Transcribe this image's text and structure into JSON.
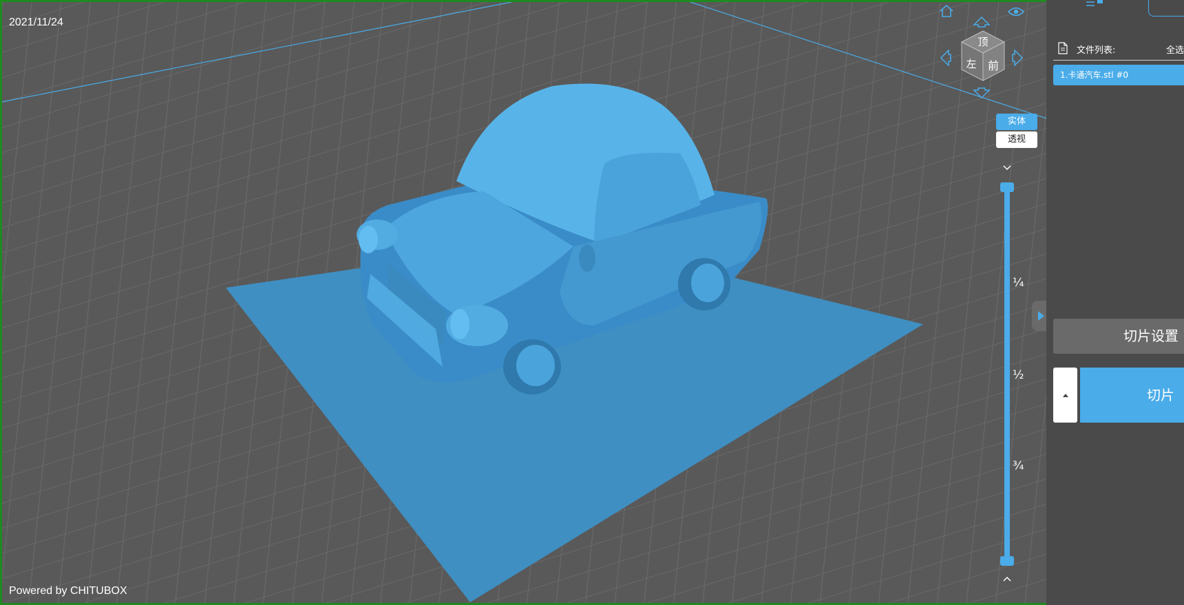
{
  "viewport": {
    "date": "2021/11/24",
    "powered_by": "Powered by CHITUBOX",
    "view_cube": {
      "top": "顶",
      "front": "前",
      "left": "左"
    },
    "view_modes": {
      "solid": "实体",
      "perspective": "透视"
    },
    "layer_slider": {
      "quarter": "¼",
      "half": "½",
      "three_quarter": "¾"
    }
  },
  "sidebar": {
    "file_list_label": "文件列表:",
    "select_all": "全选",
    "files": [
      "1.卡通汽车.stl #0"
    ],
    "slice_settings": "切片设置",
    "slice": "切片"
  },
  "colors": {
    "accent": "#4aace9",
    "viewport_bg": "#595959",
    "sidebar_bg": "#4a4a4a",
    "model": "#4aa8e0"
  },
  "icons": [
    "home-icon",
    "eye-icon",
    "arrow-up-icon",
    "arrow-left-icon",
    "arrow-right-icon",
    "arrow-down-icon",
    "chevron-down-icon",
    "chevron-up-icon",
    "file-icon",
    "collapse-arrow-icon",
    "caret-up-icon",
    "menu-icon"
  ]
}
